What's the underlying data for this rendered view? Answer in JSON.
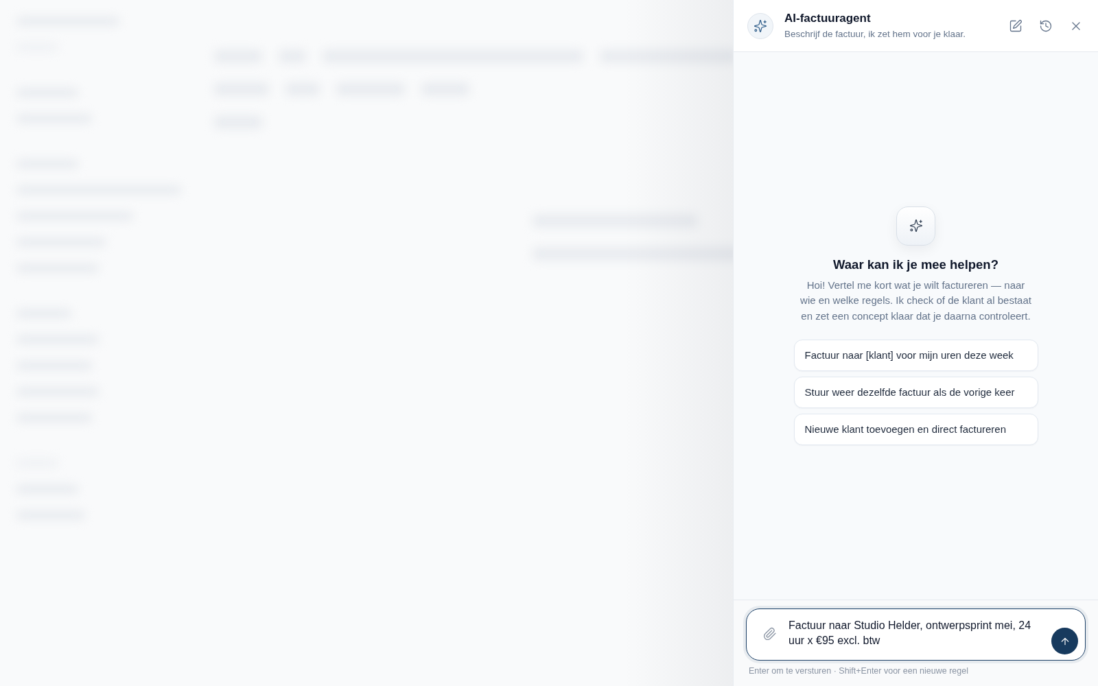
{
  "panel": {
    "title": "AI-factuuragent",
    "subtitle": "Beschrijf de factuur, ik zet hem voor je klaar."
  },
  "empty_state": {
    "heading": "Waar kan ik je mee helpen?",
    "text": "Hoi! Vertel me kort wat je wilt factureren — naar wie en welke regels. Ik check of de klant al bestaat en zet een concept klaar dat je daarna controleert."
  },
  "suggestions": [
    "Factuur naar [klant] voor mijn uren deze week",
    "Stuur weer dezelfde factuur als de vorige keer",
    "Nieuwe klant toevoegen en direct factureren"
  ],
  "composer": {
    "value": "Factuur naar Studio Helder, ontwerpsprint mei, 24 uur x €95 excl. btw",
    "focused": true,
    "hint": "Enter om te versturen · Shift+Enter voor een nieuwe regel"
  }
}
